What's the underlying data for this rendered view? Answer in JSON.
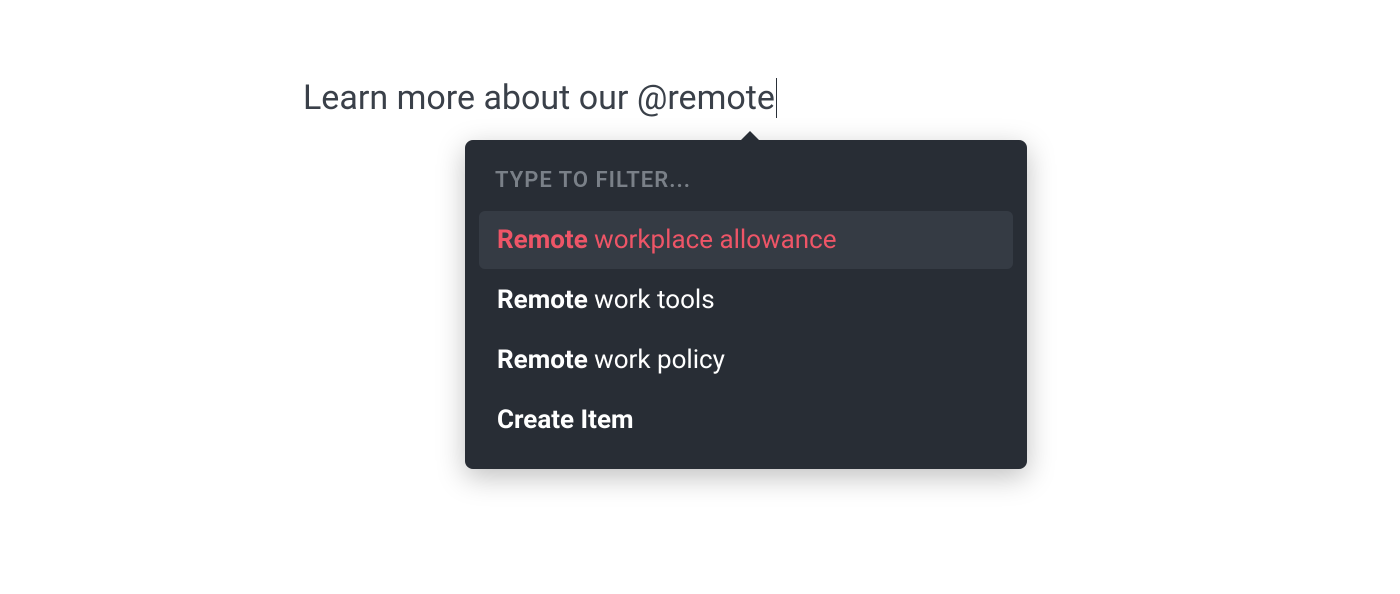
{
  "editor": {
    "text_prefix": "Learn more about our ",
    "mention_trigger": "@remote"
  },
  "popover": {
    "filter_label": "TYPE TO FILTER...",
    "options": [
      {
        "match": "Remote",
        "rest": " workplace allowance",
        "selected": true
      },
      {
        "match": "Remote",
        "rest": " work tools",
        "selected": false
      },
      {
        "match": "Remote",
        "rest": " work policy",
        "selected": false
      }
    ],
    "create_label": "Create Item"
  }
}
